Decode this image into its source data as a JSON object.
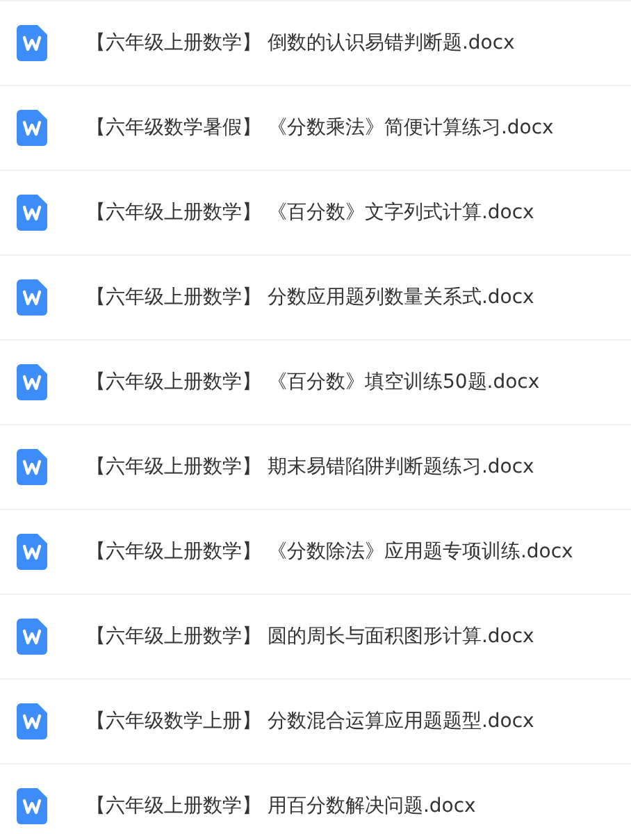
{
  "files": [
    {
      "name": "【六年级上册数学】 倒数的认识易错判断题.docx"
    },
    {
      "name": "【六年级数学暑假】 《分数乘法》简便计算练习.docx"
    },
    {
      "name": "【六年级上册数学】 《百分数》文字列式计算.docx"
    },
    {
      "name": "【六年级上册数学】 分数应用题列数量关系式.docx"
    },
    {
      "name": "【六年级上册数学】 《百分数》填空训练50题.docx"
    },
    {
      "name": "【六年级上册数学】 期末易错陷阱判断题练习.docx"
    },
    {
      "name": "【六年级上册数学】 《分数除法》应用题专项训练.docx"
    },
    {
      "name": "【六年级上册数学】 圆的周长与面积图形计算.docx"
    },
    {
      "name": "【六年级数学上册】 分数混合运算应用题题型.docx"
    },
    {
      "name": "【六年级上册数学】 用百分数解决问题.docx"
    }
  ]
}
